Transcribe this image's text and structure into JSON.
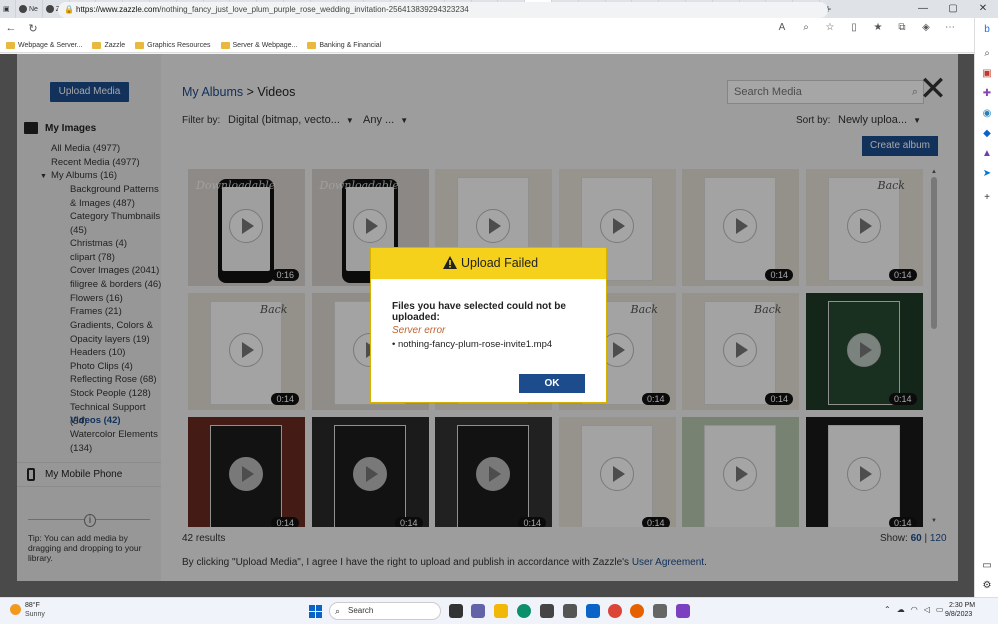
{
  "browser": {
    "tabs": [
      {
        "label": "Ne"
      },
      {
        "label": "Zaz"
      },
      {
        "label": "Me"
      },
      {
        "label": "Zin"
      },
      {
        "label": "Silv"
      },
      {
        "label": "To I"
      },
      {
        "label": "Mo"
      },
      {
        "label": "Gol"
      },
      {
        "label": "Mo"
      },
      {
        "label": "Gol"
      },
      {
        "label": "Sim"
      },
      {
        "label": "Ele"
      },
      {
        "label": "Silv"
      },
      {
        "label": "Ele"
      },
      {
        "label": "Silv"
      },
      {
        "label": "Lac"
      },
      {
        "label": "Rus"
      },
      {
        "label": "Nol"
      },
      {
        "label": "Ele"
      },
      {
        "label": "",
        "active": true
      },
      {
        "label": "Ros"
      },
      {
        "label": "Ele"
      },
      {
        "label": "Ele"
      },
      {
        "label": "Wh"
      },
      {
        "label": "We"
      },
      {
        "label": "Ele"
      },
      {
        "label": "Zin"
      },
      {
        "label": "Wa"
      },
      {
        "label": "Pin"
      },
      {
        "label": "Exp"
      }
    ],
    "url_host": "https://www.zazzle.com",
    "url_path": "/nothing_fancy_just_love_plum_purple_rose_wedding_invitation-256413839294323234",
    "bookmarks": [
      {
        "label": "Webpage & Server..."
      },
      {
        "label": "Zazzle"
      },
      {
        "label": "Graphics Resources"
      },
      {
        "label": "Server & Webpage..."
      },
      {
        "label": "Banking & Financial"
      }
    ]
  },
  "left_panel": {
    "upload_label": "Upload Media",
    "my_images_label": "My Images",
    "all_media": "All Media (4977)",
    "recent_media": "Recent Media (4977)",
    "my_albums": "My Albums (16)",
    "albums": [
      {
        "label": "Background Patterns & Images (487)"
      },
      {
        "label": "Category Thumbnails (45)"
      },
      {
        "label": "Christmas (4)"
      },
      {
        "label": "clipart (78)"
      },
      {
        "label": "Cover Images (2041)"
      },
      {
        "label": "filigree & borders (46)"
      },
      {
        "label": "Flowers (16)"
      },
      {
        "label": "Frames (21)"
      },
      {
        "label": "Gradients, Colors & Opacity layers (19)"
      },
      {
        "label": "Headers (10)"
      },
      {
        "label": "Photo Clips (4)"
      },
      {
        "label": "Reflecting Rose (68)"
      },
      {
        "label": "Stock People (128)"
      },
      {
        "label": "Technical Support (54)"
      },
      {
        "label": "Videos (42)",
        "active": true
      },
      {
        "label": "Watercolor Elements (134)"
      }
    ],
    "mobile_label": "My Mobile Phone",
    "tip": "Tip: You can add media by dragging and dropping to your library."
  },
  "main": {
    "breadcrumb_link": "My Albums",
    "breadcrumb_sep": " > ",
    "breadcrumb_current": "Videos",
    "search_placeholder": "Search Media",
    "filter_label": "Filter by:",
    "filter_type": "Digital (bitmap, vecto...",
    "filter_any": "Any ...",
    "sort_label": "Sort by:",
    "sort_value": "Newly uploa...",
    "create_album": "Create album",
    "results": "42 results",
    "show_label": "Show:",
    "show_60": "60",
    "show_sep": " | ",
    "show_120": "120",
    "agreement_text": "By clicking \"Upload Media\", I agree I have the right to upload and publish in accordance with Zazzle's ",
    "agreement_link": "User Agreement",
    "agreement_end": ".",
    "thumbnails": [
      {
        "duration": "0:16"
      },
      {
        "duration": ""
      },
      {
        "duration": ""
      },
      {
        "duration": ""
      },
      {
        "duration": "0:14"
      },
      {
        "duration": "0:14"
      },
      {
        "duration": "0:14"
      },
      {
        "duration": ""
      },
      {
        "duration": ""
      },
      {
        "duration": "0:14"
      },
      {
        "duration": "0:14"
      },
      {
        "duration": "0:14"
      },
      {
        "duration": "0:14"
      },
      {
        "duration": "0:14"
      },
      {
        "duration": "0:14"
      },
      {
        "duration": "0:14"
      },
      {
        "duration": ""
      },
      {
        "duration": "0:14"
      }
    ],
    "watermark": "Downloadable",
    "back_text": "Back"
  },
  "dialog": {
    "title": "Upload Failed",
    "message": "Files you have selected could not be uploaded:",
    "error": "Server error",
    "file": "nothing-fancy-plum-rose-invite1.mp4",
    "ok_label": "OK"
  },
  "taskbar": {
    "temp": "88°F",
    "weather": "Sunny",
    "search_placeholder": "Search",
    "time": "2:30 PM",
    "date": "9/8/2023"
  },
  "colors": {
    "accent": "#1d4c8c",
    "dialog_header": "#f5d11c",
    "error_text": "#c0622d"
  }
}
